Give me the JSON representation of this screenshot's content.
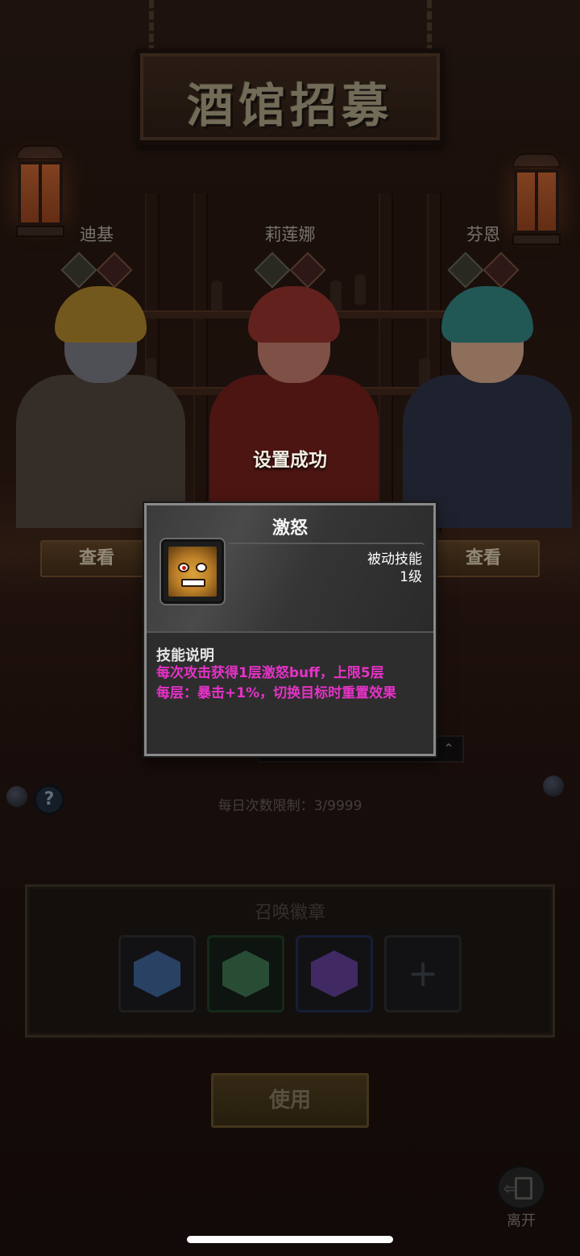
{
  "header": {
    "title": "酒馆招募"
  },
  "heroes": [
    {
      "name": "迪基",
      "view_label": "查看",
      "skin": "#6e6e78",
      "hair": "#a07a2a",
      "armor": "#4a4038"
    },
    {
      "name": "莉莲娜",
      "view_label": "查看",
      "skin": "#b07060",
      "hair": "#8a2e2a",
      "armor": "#6a1e1a"
    },
    {
      "name": "芬恩",
      "view_label": "查看",
      "skin": "#c49a80",
      "hair": "#2f7a78",
      "armor": "#2a3040"
    }
  ],
  "toast": {
    "text": "设置成功"
  },
  "skill_popup": {
    "title": "激怒",
    "type": "被动技能",
    "level": "1级",
    "desc_heading": "技能说明",
    "desc_line1": "每次攻击获得1层激怒buff，上限5层",
    "desc_line2": "每层：暴击+1%，切换目标时重置效果",
    "icon": "rage-face-icon"
  },
  "daily_limit": "每日次数限制：3/9999",
  "badge_panel": {
    "title": "召唤徽章",
    "slots": [
      {
        "icon": "blue-badge-icon",
        "color": "#3a5a8a"
      },
      {
        "icon": "green-badge-icon",
        "color": "#3a6a4a"
      },
      {
        "icon": "purple-badge-icon",
        "color": "#5a3a8a"
      },
      {
        "icon": "add-icon",
        "label": "+"
      }
    ]
  },
  "use_button": {
    "label": "使用"
  },
  "leave_button": {
    "label": "离开"
  },
  "colors": {
    "accent_text": "#e632c8",
    "popup_bg": "#2d2d2d",
    "popup_border": "#8a8a8a"
  }
}
